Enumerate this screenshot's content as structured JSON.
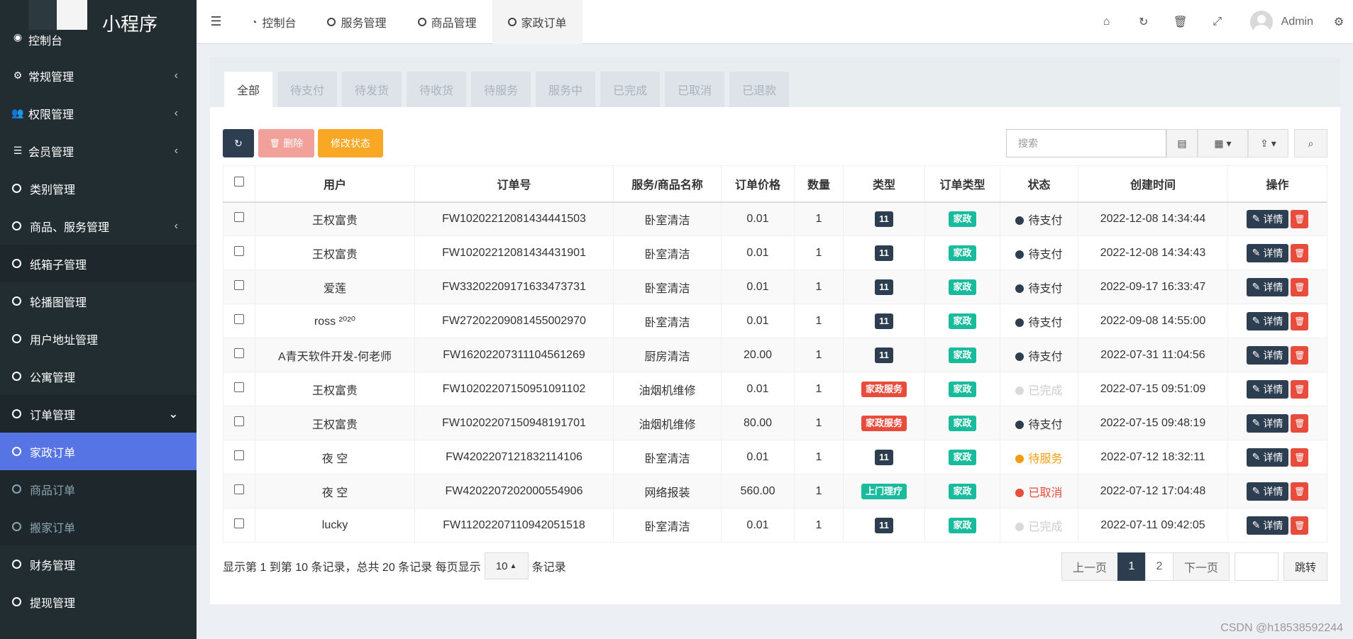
{
  "app": {
    "title": "小程序"
  },
  "sidebar": {
    "items": [
      {
        "label": "控制台",
        "icon": "dashboard-icon"
      },
      {
        "label": "常规管理",
        "icon": "cogs-icon",
        "arrow": "‹"
      },
      {
        "label": "权限管理",
        "icon": "users-icon",
        "arrow": "‹"
      },
      {
        "label": "会员管理",
        "icon": "list-icon",
        "arrow": "‹"
      },
      {
        "label": "类别管理"
      },
      {
        "label": "商品、服务管理",
        "arrow": "‹"
      },
      {
        "label": "纸箱子管理"
      },
      {
        "label": "轮播图管理"
      },
      {
        "label": "用户地址管理"
      },
      {
        "label": "公寓管理"
      },
      {
        "label": "订单管理",
        "arrow": "⌄"
      },
      {
        "label": "家政订单"
      },
      {
        "label": "商品订单"
      },
      {
        "label": "搬家订单"
      },
      {
        "label": "财务管理"
      },
      {
        "label": "提现管理"
      }
    ]
  },
  "topbar": {
    "tabs": [
      {
        "label": "控制台"
      },
      {
        "label": "服务管理"
      },
      {
        "label": "商品管理"
      },
      {
        "label": "家政订单"
      }
    ],
    "user": "Admin"
  },
  "status_tabs": [
    "全部",
    "待支付",
    "待发货",
    "待收货",
    "待服务",
    "服务中",
    "已完成",
    "已取消",
    "已退款"
  ],
  "toolbar": {
    "delete_label": "删除",
    "edit_status_label": "修改状态",
    "search_placeholder": "搜索"
  },
  "table": {
    "headers": [
      "用户",
      "订单号",
      "服务/商品名称",
      "订单价格",
      "数量",
      "类型",
      "订单类型",
      "状态",
      "创建时间",
      "操作"
    ],
    "rows": [
      [
        "王权富贵",
        "FW10202212081434441503",
        "卧室清洁",
        "0.01",
        "1",
        "11",
        "家政",
        "待支付",
        "2022-12-08 14:34:44"
      ],
      [
        "王权富贵",
        "FW10202212081434431901",
        "卧室清洁",
        "0.01",
        "1",
        "11",
        "家政",
        "待支付",
        "2022-12-08 14:34:43"
      ],
      [
        "爱莲",
        "FW33202209171633473731",
        "卧室清洁",
        "0.01",
        "1",
        "11",
        "家政",
        "待支付",
        "2022-09-17 16:33:47"
      ],
      [
        "ross ²⁰²⁰",
        "FW27202209081455002970",
        "卧室清洁",
        "0.01",
        "1",
        "11",
        "家政",
        "待支付",
        "2022-09-08 14:55:00"
      ],
      [
        "A青天软件开发-何老师",
        "FW16202207311104561269",
        "厨房清洁",
        "20.00",
        "1",
        "11",
        "家政",
        "待支付",
        "2022-07-31 11:04:56"
      ],
      [
        "王权富贵",
        "FW10202207150951091102",
        "油烟机维修",
        "0.01",
        "1",
        "家政服务",
        "家政",
        "已完成",
        "2022-07-15 09:51:09"
      ],
      [
        "王权富贵",
        "FW10202207150948191701",
        "油烟机维修",
        "80.00",
        "1",
        "家政服务",
        "家政",
        "待支付",
        "2022-07-15 09:48:19"
      ],
      [
        "夜 空",
        "FW4202207121832114106",
        "卧室清洁",
        "0.01",
        "1",
        "11",
        "家政",
        "待服务",
        "2022-07-12 18:32:11"
      ],
      [
        "夜 空",
        "FW4202207202000554906",
        "网络报装",
        "560.00",
        "1",
        "上门理疗",
        "家政",
        "已取消",
        "2022-07-12 17:04:48"
      ],
      [
        "lucky",
        "FW11202207110942051518",
        "卧室清洁",
        "0.01",
        "1",
        "11",
        "家政",
        "已完成",
        "2022-07-11 09:42:05"
      ]
    ],
    "detail_label": "详情"
  },
  "footer": {
    "info_prefix": "显示第 1 到第 10 条记录，总共 20 条记录 每页显示",
    "page_size": "10",
    "info_suffix": "条记录",
    "prev": "上一页",
    "page1": "1",
    "page2": "2",
    "next": "下一页",
    "jump": "跳转"
  },
  "watermark": "CSDN @h18538592244"
}
